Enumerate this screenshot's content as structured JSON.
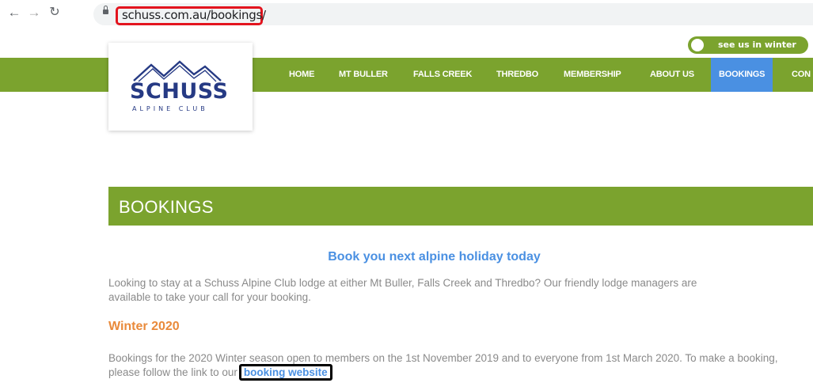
{
  "browser": {
    "url": "schuss.com.au/bookings/",
    "back_glyph": "←",
    "forward_glyph": "→",
    "reload_glyph": "↻"
  },
  "toggle": {
    "label": "see us in winter"
  },
  "nav": {
    "items": [
      "HOME",
      "MT BULLER",
      "FALLS CREEK",
      "THREDBO",
      "MEMBERSHIP",
      "ABOUT US",
      "BOOKINGS",
      "CON"
    ],
    "active": "BOOKINGS"
  },
  "logo": {
    "name": "SCHUSS",
    "subtitle": "ALPINE CLUB"
  },
  "page": {
    "title": "BOOKINGS",
    "headline": "Book you next alpine holiday today",
    "intro": "Looking to stay at a Schuss Alpine Club lodge at either Mt Buller, Falls Creek and Thredbo?  Our friendly lodge managers are available to take your call for your booking.",
    "winter_title": "Winter 2020",
    "winter_text": "Bookings for the 2020 Winter season open to members on the 1st November 2019 and to everyone from 1st March 2020.  To make a booking, please follow the link to our",
    "link_text": "booking website"
  },
  "colors": {
    "brand_green": "#7ba32e",
    "accent_blue": "#4a90e2",
    "heading_orange": "#e98a3b",
    "logo_navy": "#263a84",
    "highlight_red": "#e3141e"
  }
}
